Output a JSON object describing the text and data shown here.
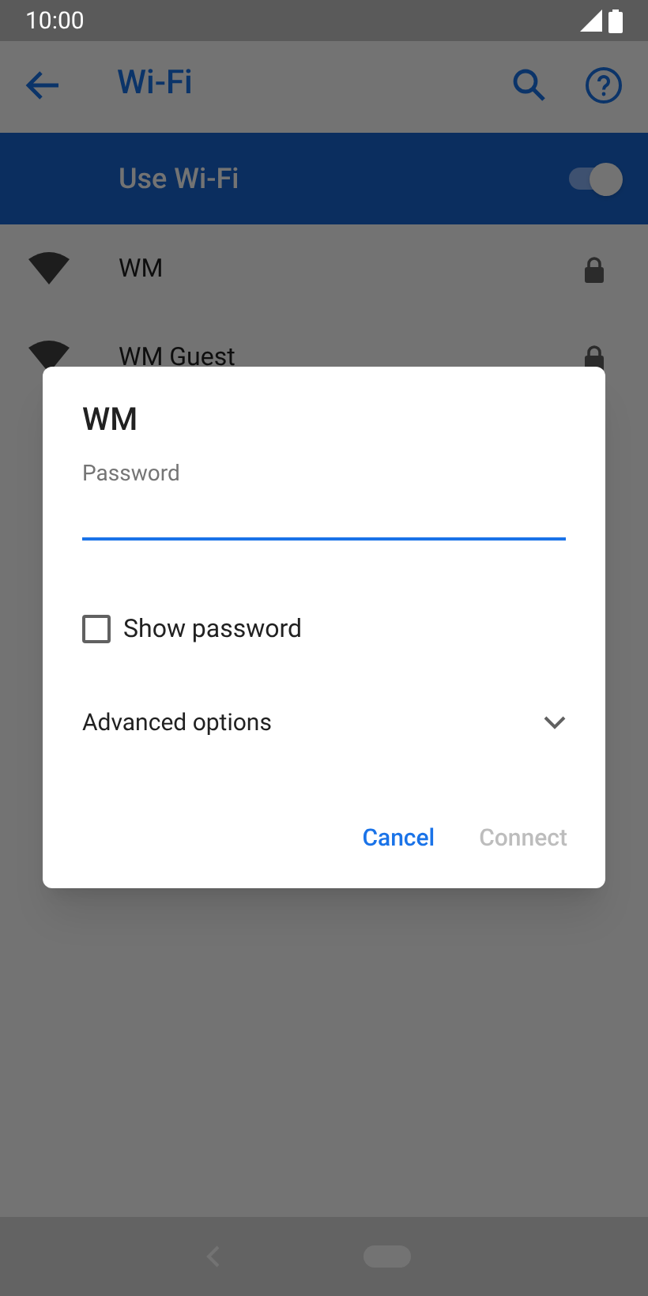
{
  "status_bar": {
    "time": "10:00"
  },
  "app_bar": {
    "title": "Wi-Fi"
  },
  "wifi_toggle": {
    "label": "Use Wi-Fi",
    "on": true
  },
  "networks": [
    {
      "name": "WM",
      "locked": true
    },
    {
      "name": "WM Guest",
      "locked": true
    }
  ],
  "dialog": {
    "title": "WM",
    "password_field": {
      "label": "Password"
    },
    "show_password": {
      "label": "Show password",
      "checked": false
    },
    "advanced_options": {
      "label": "Advanced options",
      "expanded": false
    },
    "buttons": [
      {
        "label": "Cancel",
        "disabled": false
      },
      {
        "label": "Connect",
        "disabled": true
      }
    ]
  }
}
